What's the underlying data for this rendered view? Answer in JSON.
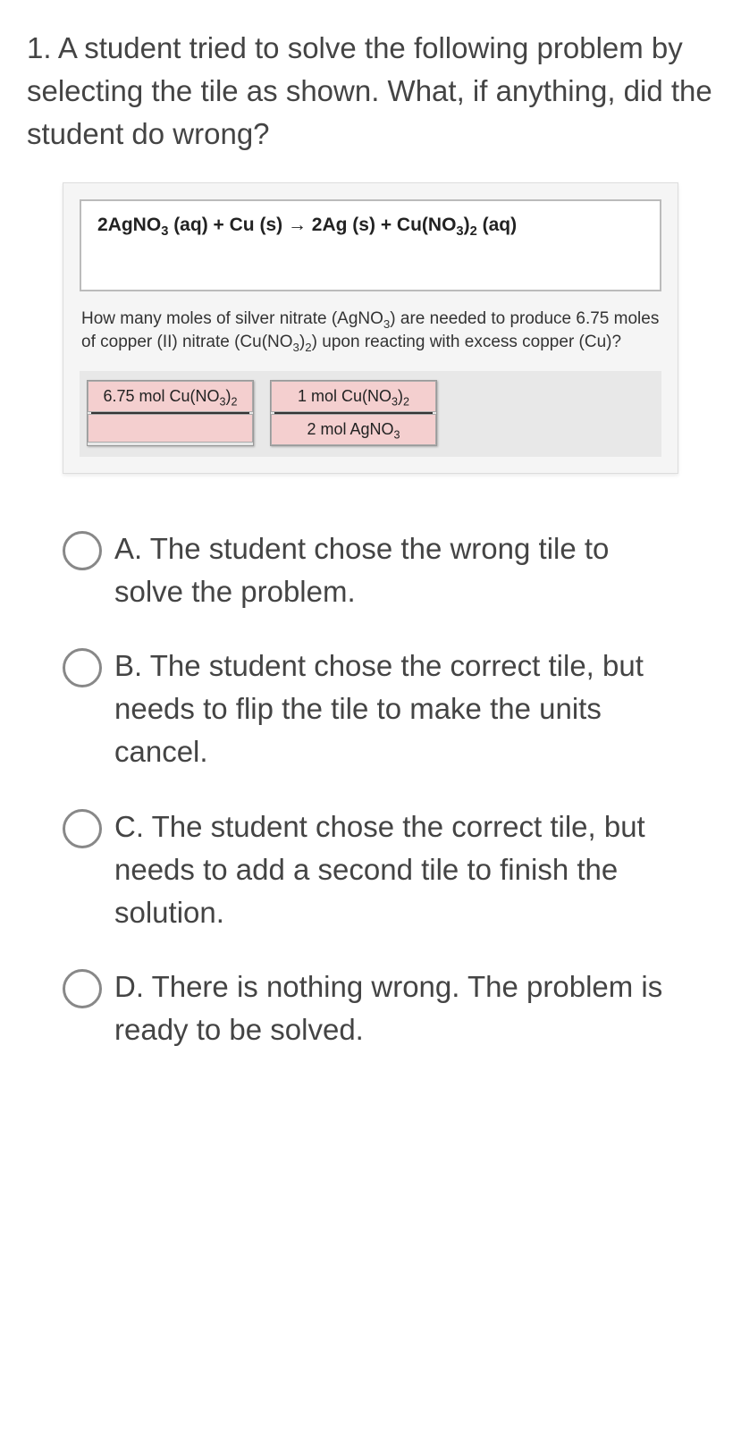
{
  "question": {
    "prompt": "1. A student tried to solve the following problem by selecting the tile as shown. What, if anything, did the student do wrong?"
  },
  "problem": {
    "equation": {
      "reactant1_coef": "2",
      "reactant1": "AgNO",
      "reactant1_sub": "3",
      "reactant1_state": " (aq)",
      "plus1": " + ",
      "reactant2": "Cu (s)",
      "arrow": " → ",
      "product1_coef": "2",
      "product1": "Ag (s)",
      "plus2": " + ",
      "product2": "Cu(NO",
      "product2_sub1": "3",
      "product2_paren": ")",
      "product2_sub2": "2",
      "product2_state": " (aq)"
    },
    "text_parts": {
      "p1": "How many moles of silver nitrate (AgNO",
      "p1_sub": "3",
      "p2": ") are needed to produce 6.75 moles of copper (II) nitrate (Cu(NO",
      "p2_sub1": "3",
      "p3": ")",
      "p2_sub2": "2",
      "p4": ") upon reacting with excess copper (Cu)?"
    },
    "tiles": {
      "tile1": {
        "top_prefix": "6.75 mol Cu(NO",
        "top_sub1": "3",
        "top_mid": ")",
        "top_sub2": "2",
        "bottom": ""
      },
      "tile2": {
        "top_prefix": "1 mol Cu(NO",
        "top_sub1": "3",
        "top_mid": ")",
        "top_sub2": "2",
        "bottom_prefix": "2 mol AgNO",
        "bottom_sub": "3"
      }
    }
  },
  "answers": {
    "a": "A. The student chose the wrong tile to solve the problem.",
    "b": "B. The student chose the correct tile, but needs to flip the tile to make the units cancel.",
    "c": "C. The student chose the correct tile, but needs to add a second tile to finish the solution.",
    "d": "D. There is nothing wrong. The problem is ready to be solved."
  }
}
